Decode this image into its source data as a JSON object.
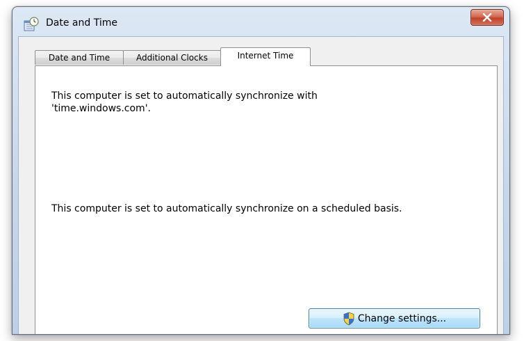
{
  "window": {
    "title": "Date and Time",
    "app_icon": "date-time-icon",
    "close_icon": "close-icon"
  },
  "tabs": [
    {
      "label": "Date and Time",
      "active": false
    },
    {
      "label": "Additional Clocks",
      "active": false
    },
    {
      "label": "Internet Time",
      "active": true
    }
  ],
  "internet_time": {
    "sync_server_text": "This computer is set to automatically synchronize with 'time.windows.com'.",
    "schedule_text": "This computer is set to automatically synchronize on a scheduled basis.",
    "change_settings_label": "Change settings...",
    "change_settings_icon": "uac-shield-icon"
  },
  "colors": {
    "close_button": "#c2412a",
    "titlebar": "#c7d7ea",
    "button_border": "#3c7fb1"
  }
}
